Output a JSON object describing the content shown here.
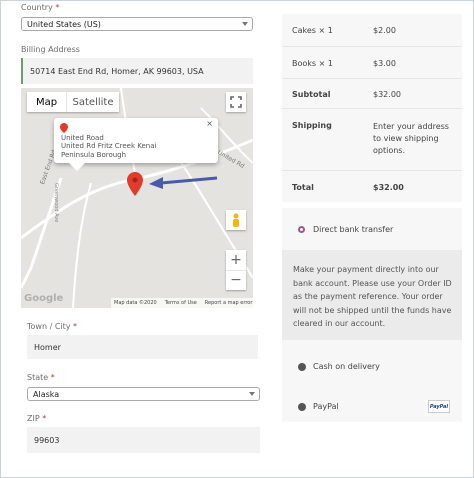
{
  "billing": {
    "country_label": "Country",
    "required_mark": "*",
    "country_value": "United States (US)",
    "billing_address_label": "Billing Address",
    "billing_address_value": "50714 East End Rd, Homer, AK 99603, USA",
    "city_label": "Town / City",
    "city_value": "Homer",
    "state_label": "State",
    "state_value": "Alaska",
    "zip_label": "ZIP",
    "zip_value": "99603"
  },
  "map": {
    "tab_map": "Map",
    "tab_satellite": "Satellite",
    "info_title": "United Road",
    "info_address": "United Rd Fritz Creek Kenai Peninsula Borough",
    "road_label_east_end": "East End Rd",
    "road_label_united": "United Rd",
    "road_label_greenwood": "Greenwood Ave",
    "zoom_in": "+",
    "zoom_out": "−",
    "google_logo": "Google",
    "map_data": "Map data ©2020",
    "terms": "Terms of Use",
    "report": "Report a map error",
    "arrow_color": "#4a5aa8",
    "pin_color": "#e03b2b"
  },
  "order_summary": {
    "items": [
      {
        "name": "Cakes × 1",
        "price": "$2.00"
      },
      {
        "name": "Books × 1",
        "price": "$3.00"
      }
    ],
    "subtotal_label": "Subtotal",
    "subtotal_value": "$32.00",
    "shipping_label": "Shipping",
    "shipping_value": "Enter your address to view shipping options.",
    "total_label": "Total",
    "total_value": "$32.00"
  },
  "payment": {
    "methods": [
      {
        "label": "Direct bank transfer",
        "selected": true
      },
      {
        "label": "Cash on delivery",
        "selected": false
      },
      {
        "label": "PayPal",
        "selected": false
      }
    ],
    "bank_description": "Make your payment directly into our bank account. Please use your Order ID as the payment reference. Your order will not be shipped until the funds have cleared in our account.",
    "paypal_badge": "PayPal",
    "accent_color": "#96588a"
  }
}
